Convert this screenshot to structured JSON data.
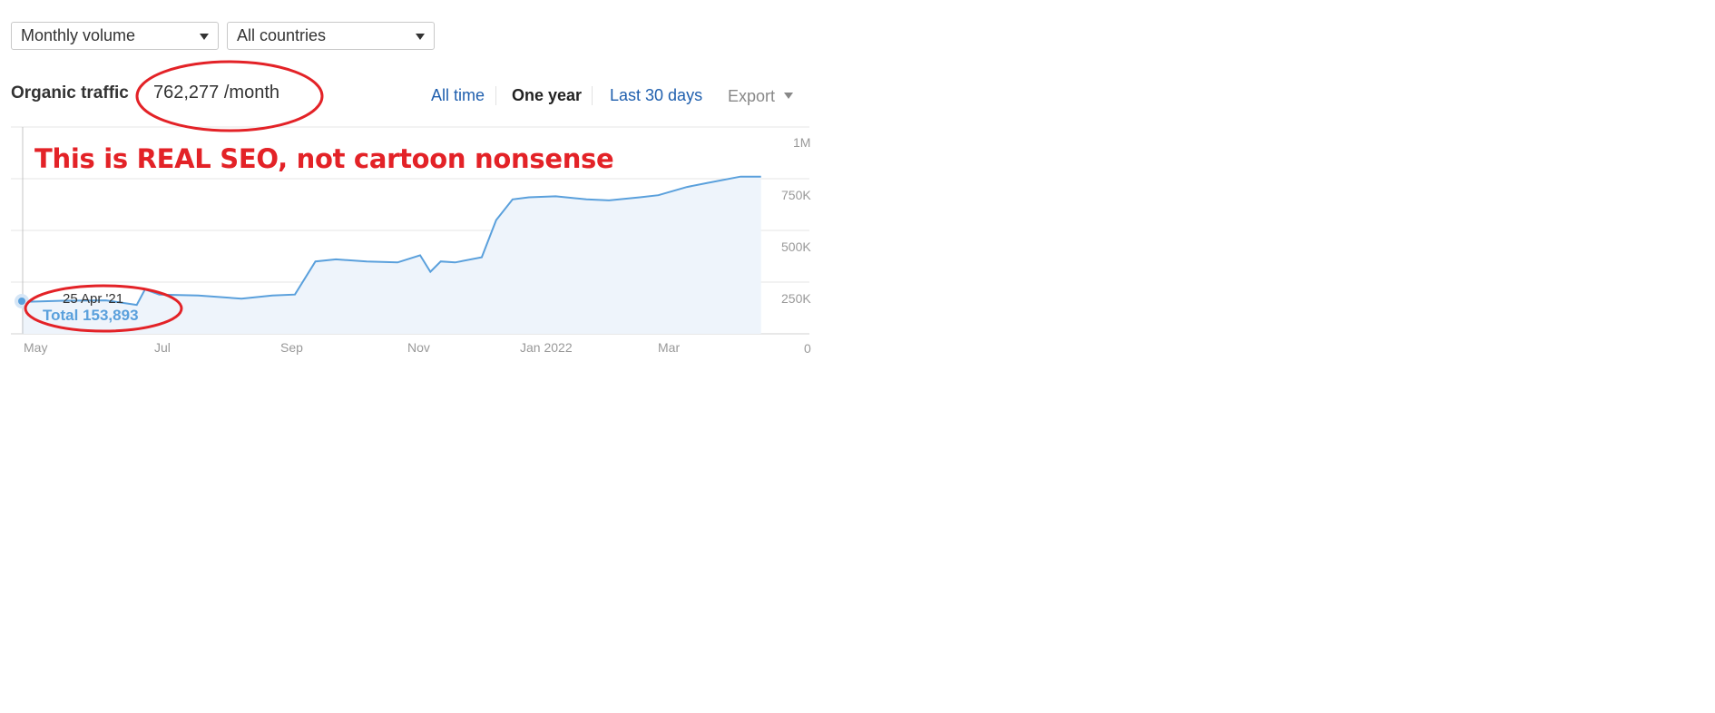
{
  "filters": {
    "volume": "Monthly volume",
    "country": "All countries"
  },
  "header": {
    "title": "Organic traffic",
    "value": "762,277 /month"
  },
  "range_tabs": [
    {
      "label": "All time",
      "active": false
    },
    {
      "label": "One year",
      "active": true
    },
    {
      "label": "Last 30 days",
      "active": false
    }
  ],
  "export_label": "Export",
  "annotation": "This is REAL SEO, not cartoon nonsense",
  "tooltip": {
    "date": "25 Apr '21",
    "total": "Total 153,893"
  },
  "colors": {
    "line": "#5aa0dc",
    "area": "#eef4fb",
    "annotation": "#e32227",
    "link": "#1f5fae"
  },
  "chart_data": {
    "type": "area",
    "title": "Organic traffic",
    "x_tick_labels": [
      "May",
      "Jul",
      "Sep",
      "Nov",
      "Jan 2022",
      "Mar"
    ],
    "y_tick_labels": [
      "1M",
      "750K",
      "500K",
      "250K",
      "0"
    ],
    "ylim": [
      0,
      1000000
    ],
    "grid": true,
    "series": [
      {
        "x": [
          "2021-04-25",
          "2021-05-15",
          "2021-06-05",
          "2021-06-20",
          "2021-06-24",
          "2021-07-01",
          "2021-07-20",
          "2021-08-10",
          "2021-08-25",
          "2021-09-05",
          "2021-09-15",
          "2021-09-25",
          "2021-10-10",
          "2021-10-25",
          "2021-11-05",
          "2021-11-10",
          "2021-11-15",
          "2021-11-22",
          "2021-12-05",
          "2021-12-12",
          "2021-12-20",
          "2021-12-28",
          "2022-01-10",
          "2022-01-25",
          "2022-02-05",
          "2022-02-20",
          "2022-03-01",
          "2022-03-15",
          "2022-03-25",
          "2022-04-10",
          "2022-04-20"
        ],
        "values": [
          153893,
          160000,
          162000,
          140000,
          215000,
          190000,
          185000,
          170000,
          185000,
          190000,
          350000,
          360000,
          350000,
          345000,
          380000,
          300000,
          350000,
          345000,
          370000,
          550000,
          650000,
          660000,
          665000,
          650000,
          645000,
          660000,
          670000,
          710000,
          730000,
          760000,
          760000
        ]
      }
    ]
  }
}
